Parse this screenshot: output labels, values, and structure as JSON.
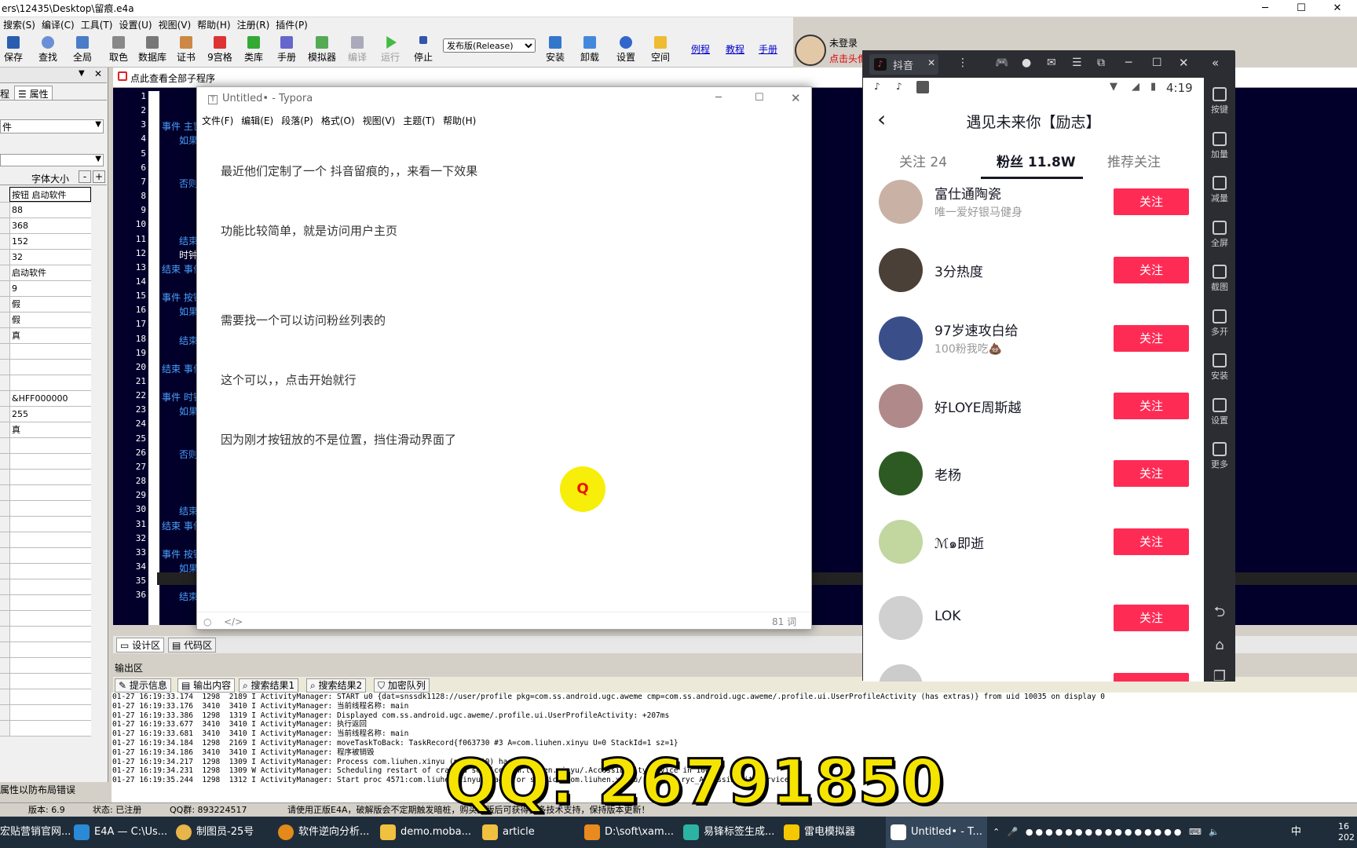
{
  "window_title": "ers\\12435\\Desktop\\留痕.e4a",
  "menubar": [
    "搜索(S)",
    "编译(C)",
    "工具(T)",
    "设置(U)",
    "视图(V)",
    "帮助(H)",
    "注册(R)",
    "插件(P)"
  ],
  "toolbar": {
    "buttons": [
      "保存",
      "查找",
      "全局",
      "取色",
      "数据库",
      "证书",
      "9宫格",
      "类库",
      "手册",
      "模拟器",
      "编译",
      "运行",
      "停止",
      "安装",
      "卸载",
      "设置",
      "空间"
    ],
    "build_mode": "发布版(Release)",
    "links": [
      "例程",
      "教程",
      "手册"
    ],
    "login_status": "未登录",
    "login_hint": "点击头像"
  },
  "left_panel": {
    "tab_label": "属性",
    "tab_partial": "程",
    "sel_value": "件",
    "col_header": "字体大小",
    "rows": [
      "按钮 启动软件",
      "88",
      "368",
      "152",
      "32",
      "启动软件",
      "9",
      "假",
      "假",
      "真",
      "",
      "",
      "",
      "&HFF000000",
      "255",
      "真"
    ],
    "footer": "属性以防布局错误"
  },
  "editor": {
    "header": "点此查看全部子程序",
    "line_numbers": [
      "1",
      "2",
      "3",
      "4",
      "5",
      "6",
      "7",
      "8",
      "9",
      "10",
      "11",
      "12",
      "13",
      "14",
      "15",
      "16",
      "17",
      "18",
      "19",
      "20",
      "21",
      "22",
      "23",
      "24",
      "25",
      "26",
      "27",
      "28",
      "29",
      "30",
      "31",
      "32",
      "33",
      "34",
      "35",
      "36"
    ],
    "code": [
      {
        "line": 3,
        "text": "事件 主窗"
      },
      {
        "line": 4,
        "text": "如果"
      },
      {
        "line": 7,
        "text": "否则"
      },
      {
        "line": 11,
        "text": "结束"
      },
      {
        "line": 12,
        "text": "时钟"
      },
      {
        "line": 13,
        "text": "结束 事件"
      },
      {
        "line": 15,
        "text": "事件 按钮"
      },
      {
        "line": 16,
        "text": "如果"
      },
      {
        "line": 18,
        "text": "结束"
      },
      {
        "line": 20,
        "text": "结束 事件"
      },
      {
        "line": 22,
        "text": "事件 时钟"
      },
      {
        "line": 23,
        "text": "如果"
      },
      {
        "line": 26,
        "text": "否则"
      },
      {
        "line": 30,
        "text": "结束"
      },
      {
        "line": 31,
        "text": "结束 事件"
      },
      {
        "line": 33,
        "text": "事件 按钮"
      },
      {
        "line": 34,
        "text": "如果"
      },
      {
        "line": 36,
        "text": "结束"
      }
    ],
    "tabs": [
      "设计区",
      "代码区"
    ]
  },
  "output": {
    "header": "输出区",
    "tabs": [
      "提示信息",
      "输出内容",
      "搜索结果1",
      "搜索结果2",
      "加密队列"
    ],
    "lines": [
      "01-27 16:19:33.174  1298  2189 I ActivityManager: START u0 {dat=snssdk1128://user/profile pkg=com.ss.android.ugc.aweme cmp=com.ss.android.ugc.aweme/.profile.ui.UserProfileActivity (has extras)} from uid 10035 on display 0",
      "01-27 16:19:33.176  3410  3410 I ActivityManager: 当前线程名称: main",
      "01-27 16:19:33.386  1298  1319 I ActivityManager: Displayed com.ss.android.ugc.aweme/.profile.ui.UserProfileActivity: +207ms",
      "01-27 16:19:33.677  3410  3410 I ActivityManager: 执行返回",
      "01-27 16:19:33.681  3410  3410 I ActivityManager: 当前线程名称: main",
      "01-27 16:19:34.184  1298  2169 I ActivityManager: moveTaskToBack: TaskRecord{f063730 #3 A=com.liuhen.xinyu U=0 StackId=1 sz=1}",
      "01-27 16:19:34.186  3410  3410 I ActivityManager: 程序被销毁",
      "01-27 16:19:34.217  1298  1309 I ActivityManager: Process com.liuhen.xinyu (pid 3410) has died",
      "01-27 16:19:34.231  1298  1309 W ActivityManager: Scheduling restart of crashed service com.liuhen.xinyu/.AccessibilityService in 1000ms",
      "01-27 16:19:35.244  1298  1312 I ActivityManager: Start proc 4571:com.liuhen.xinyu/u0a41 for service com.liuhen.xinyu/.辅助类库.ryc_AccessibilityService"
    ]
  },
  "statusbar": {
    "version": "版本: 6.9",
    "state": "状态: 已注册",
    "qq_group": "QQ群: 893224517",
    "notice": "请使用正版E4A，破解版会不定期触发暗桩，购买正版后可获得更多技术支持，保持版本更新！"
  },
  "typora": {
    "title": "Untitled• - Typora",
    "menu": [
      "文件(F)",
      "编辑(E)",
      "段落(P)",
      "格式(O)",
      "视图(V)",
      "主题(T)",
      "帮助(H)"
    ],
    "paragraphs": [
      "最近他们定制了一个 抖音留痕的，，来看一下效果",
      "功能比较简单，就是访问用户主页",
      "需要找一个可以访问粉丝列表的",
      "这个可以，，点击开始就行",
      "因为刚才按钮放的不是位置，挡住滑动界面了"
    ],
    "word_count": "81 词"
  },
  "cursor_label": "Q",
  "emulator": {
    "tab_title": "抖音",
    "side_buttons": [
      "按键",
      "加量",
      "减量",
      "全屏",
      "截图",
      "多开",
      "安装",
      "设置",
      "更多"
    ],
    "phone": {
      "time": "4:19",
      "title": "遇见未来你【励志】",
      "tabs": [
        "关注 24",
        "粉丝 11.8W",
        "推荐关注"
      ],
      "active_tab": 1,
      "follow_label": "关注",
      "fans": [
        {
          "name": "富仕通陶瓷",
          "signature": "唯一爱好银马健身"
        },
        {
          "name": "3分热度",
          "signature": ""
        },
        {
          "name": "97岁速攻白给",
          "signature": "100粉我吃💩"
        },
        {
          "name": "好LOYE周斯越",
          "signature": ""
        },
        {
          "name": "老杨",
          "signature": ""
        },
        {
          "name": "ℳ๑即逝",
          "signature": ""
        },
        {
          "name": "LOK",
          "signature": ""
        }
      ]
    }
  },
  "taskbar": {
    "items": [
      "E4A — C:\\Us...",
      "制图员-25号",
      "软件逆向分析...",
      "demo.moba...",
      "article",
      "D:\\soft\\xam...",
      "易锋标签生成...",
      "雷电模拟器",
      "Untitled• - T..."
    ],
    "left_partial": "宏贴营销官网...",
    "ime": "中",
    "clock_partial": "16\n202"
  },
  "overlay_text": "QQ: 26791850",
  "colors": {
    "douyin_red": "#fe2c55",
    "editor_bg": "#02002a",
    "banner_yellow": "#f5e400"
  }
}
